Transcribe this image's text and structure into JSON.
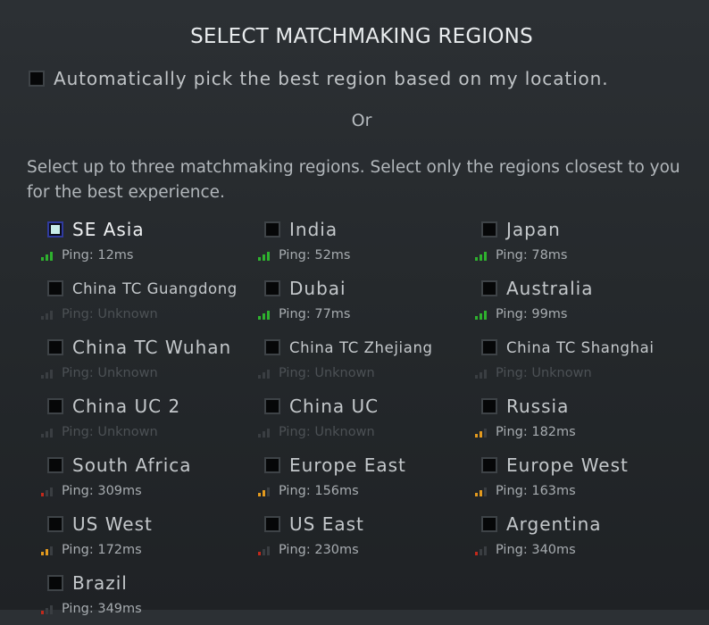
{
  "title": "SELECT MATCHMAKING REGIONS",
  "auto_pick": {
    "label": "Automatically pick the best region based on my location.",
    "checked": false
  },
  "or_label": "Or",
  "instructions": "Select up to three matchmaking regions. Select only the regions closest to you for the best experience.",
  "colors": {
    "good": "#2eb22e",
    "medium": "#e39a1e",
    "bad": "#c3291b",
    "dim": "#3a3e42",
    "checkbox_selected_border": "#2f3a9e",
    "checkbox_selected_fill": "#c7ebe9"
  },
  "regions": [
    {
      "name": "SE Asia",
      "ping": "Ping: 12ms",
      "checked": true,
      "signal": "good",
      "level": 3
    },
    {
      "name": "India",
      "ping": "Ping: 52ms",
      "checked": false,
      "signal": "good",
      "level": 3
    },
    {
      "name": "Japan",
      "ping": "Ping: 78ms",
      "checked": false,
      "signal": "good",
      "level": 3
    },
    {
      "name": "China TC Guangdong",
      "ping": "Ping: Unknown",
      "checked": false,
      "signal": "unknown",
      "level": 0
    },
    {
      "name": "Dubai",
      "ping": "Ping: 77ms",
      "checked": false,
      "signal": "good",
      "level": 3
    },
    {
      "name": "Australia",
      "ping": "Ping: 99ms",
      "checked": false,
      "signal": "good",
      "level": 3
    },
    {
      "name": "China TC Wuhan",
      "ping": "Ping: Unknown",
      "checked": false,
      "signal": "unknown",
      "level": 0
    },
    {
      "name": "China TC Zhejiang",
      "ping": "Ping: Unknown",
      "checked": false,
      "signal": "unknown",
      "level": 0
    },
    {
      "name": "China TC Shanghai",
      "ping": "Ping: Unknown",
      "checked": false,
      "signal": "unknown",
      "level": 0
    },
    {
      "name": "China UC 2",
      "ping": "Ping: Unknown",
      "checked": false,
      "signal": "unknown",
      "level": 0
    },
    {
      "name": "China UC",
      "ping": "Ping: Unknown",
      "checked": false,
      "signal": "unknown",
      "level": 0
    },
    {
      "name": "Russia",
      "ping": "Ping: 182ms",
      "checked": false,
      "signal": "medium",
      "level": 2
    },
    {
      "name": "South Africa",
      "ping": "Ping: 309ms",
      "checked": false,
      "signal": "bad",
      "level": 1
    },
    {
      "name": "Europe East",
      "ping": "Ping: 156ms",
      "checked": false,
      "signal": "medium",
      "level": 2
    },
    {
      "name": "Europe West",
      "ping": "Ping: 163ms",
      "checked": false,
      "signal": "medium",
      "level": 2
    },
    {
      "name": "US West",
      "ping": "Ping: 172ms",
      "checked": false,
      "signal": "medium",
      "level": 2
    },
    {
      "name": "US East",
      "ping": "Ping: 230ms",
      "checked": false,
      "signal": "bad",
      "level": 1
    },
    {
      "name": "Argentina",
      "ping": "Ping: 340ms",
      "checked": false,
      "signal": "bad",
      "level": 1
    },
    {
      "name": "Brazil",
      "ping": "Ping: 349ms",
      "checked": false,
      "signal": "bad",
      "level": 1
    }
  ]
}
